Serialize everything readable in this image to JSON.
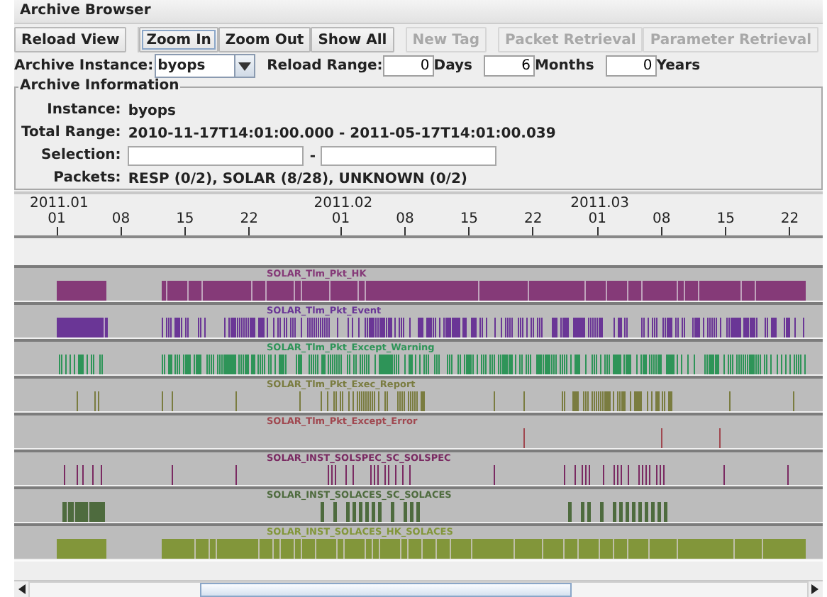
{
  "window": {
    "title": "Archive Browser"
  },
  "toolbar_groups": [
    [
      {
        "label": "Reload View",
        "disabled": false,
        "focused": false
      }
    ],
    [
      {
        "label": "Zoom In",
        "disabled": false,
        "focused": true
      },
      {
        "label": "Zoom Out",
        "disabled": false,
        "focused": false
      },
      {
        "label": "Show All",
        "disabled": false,
        "focused": false
      }
    ],
    [
      {
        "label": "New Tag",
        "disabled": true,
        "focused": false
      }
    ],
    [
      {
        "label": "Packet Retrieval",
        "disabled": true,
        "focused": false
      },
      {
        "label": "Parameter Retrieval",
        "disabled": true,
        "focused": false
      }
    ]
  ],
  "archive_instance": {
    "label": "Archive Instance:",
    "value": "byops"
  },
  "reload_range": {
    "label": "Reload Range:",
    "fields": [
      {
        "value": "0",
        "unit": "Days"
      },
      {
        "value": "6",
        "unit": "Months"
      },
      {
        "value": "0",
        "unit": "Years"
      }
    ]
  },
  "archive_information": {
    "title": "Archive Information",
    "rows": [
      {
        "kind": "text",
        "label": "Instance:",
        "value": "byops"
      },
      {
        "kind": "text",
        "label": "Total Range:",
        "value": "2010-11-17T14:01:00.000 - 2011-05-17T14:01:00.039"
      },
      {
        "kind": "range",
        "label": "Selection:",
        "separator": "-"
      },
      {
        "kind": "text",
        "label": "Packets:",
        "value": "RESP (0/2), SOLAR (8/28), UNKNOWN (0/2)"
      }
    ]
  },
  "timeline": {
    "months": [
      {
        "label": "2011.01",
        "ticks": [
          "01",
          "08",
          "15",
          "22"
        ]
      },
      {
        "label": "2011.02",
        "ticks": [
          "01",
          "08",
          "15",
          "22"
        ]
      },
      {
        "label": "2011.03",
        "ticks": [
          "01",
          "08",
          "15",
          "22"
        ]
      }
    ],
    "rows": [
      {
        "label": "SOLAR_Tlm_Pkt_HK",
        "color": "#853a78"
      },
      {
        "label": "SOLAR_Tlm_Pkt_Event",
        "color": "#6a3696"
      },
      {
        "label": "SOLAR_Tlm_Pkt_Except_Warning",
        "color": "#2e9458"
      },
      {
        "label": "SOLAR_Tlm_Pkt_Exec_Report",
        "color": "#7a7c40"
      },
      {
        "label": "SOLAR_Tlm_Pkt_Except_Error",
        "color": "#a04850"
      },
      {
        "label": "SOLAR_INST_SOLSPEC_SC_SOLSPEC",
        "color": "#7a2a62"
      },
      {
        "label": "SOLAR_INST_SOLACES_SC_SOLACES",
        "color": "#4e6b3e"
      },
      {
        "label": "SOLAR_INST_SOLACES_HK_SOLACES",
        "color": "#82963a"
      }
    ]
  }
}
